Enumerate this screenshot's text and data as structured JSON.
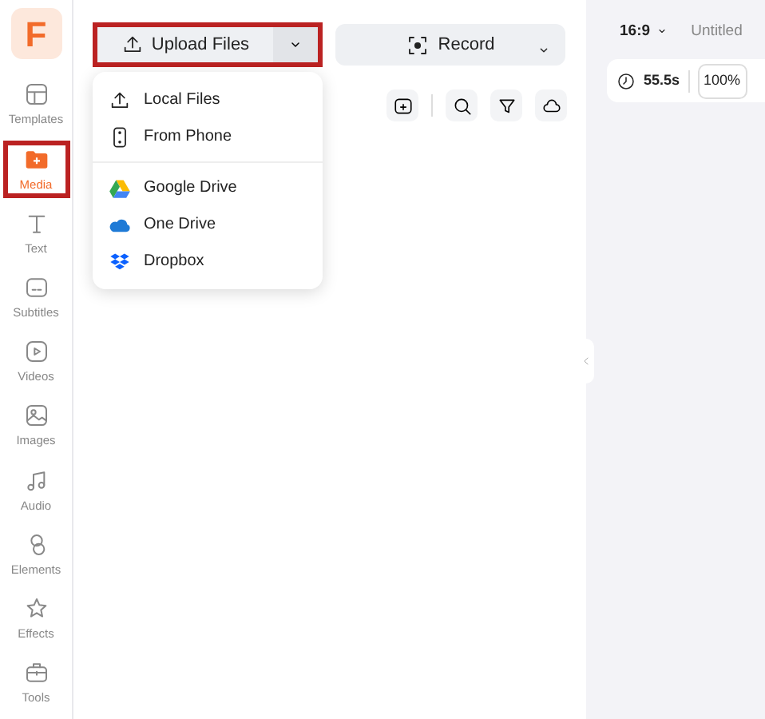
{
  "sidebar": {
    "logo": "F",
    "items": [
      {
        "label": "Templates",
        "selected": false
      },
      {
        "label": "Media",
        "selected": true
      },
      {
        "label": "Text",
        "selected": false
      },
      {
        "label": "Subtitles",
        "selected": false
      },
      {
        "label": "Videos",
        "selected": false
      },
      {
        "label": "Images",
        "selected": false
      },
      {
        "label": "Audio",
        "selected": false
      },
      {
        "label": "Elements",
        "selected": false
      },
      {
        "label": "Effects",
        "selected": false
      },
      {
        "label": "Tools",
        "selected": false
      }
    ]
  },
  "upload_button": {
    "label": "Upload Files",
    "highlighted": true
  },
  "record_button": {
    "label": "Record"
  },
  "upload_menu": {
    "groups": [
      [
        {
          "label": "Local Files"
        },
        {
          "label": "From Phone"
        }
      ],
      [
        {
          "label": "Google Drive"
        },
        {
          "label": "One Drive"
        },
        {
          "label": "Dropbox"
        }
      ]
    ]
  },
  "canvas_bar": {
    "ratio": "16:9",
    "title": "Untitled",
    "duration": "55.5s",
    "zoom": "100%"
  }
}
